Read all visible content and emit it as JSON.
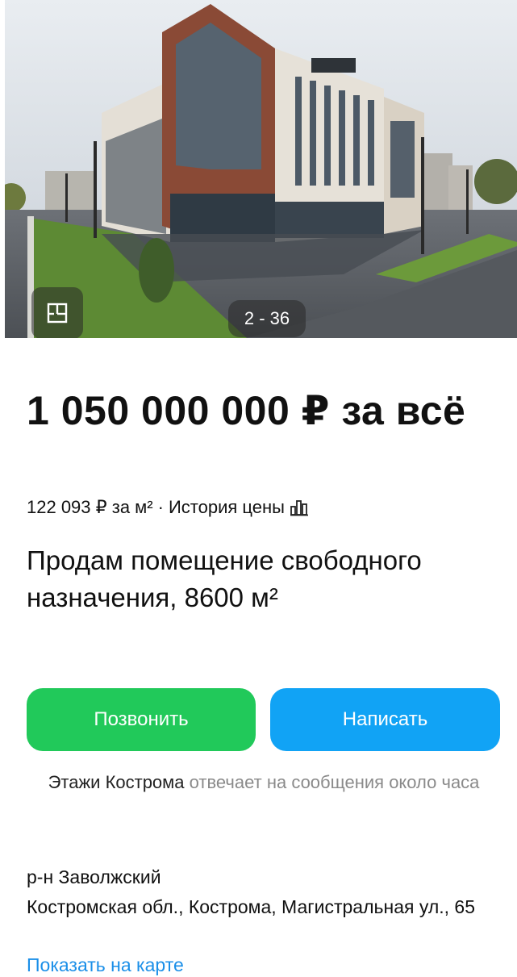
{
  "gallery": {
    "counter": "2 - 36",
    "icons": {
      "plan": "floor-plan-icon"
    }
  },
  "listing": {
    "price": "1 050 000 000 ₽ за всё",
    "price_per_m2": "122 093 ₽ за м²",
    "separator": "·",
    "price_history": "История цены",
    "title": "Продам помещение свободного назначения, 8600 м²"
  },
  "actions": {
    "call": "Позвонить",
    "write": "Написать"
  },
  "seller": {
    "name": "Этажи Кострома",
    "response_text": "отвечает на сообщения около часа"
  },
  "location": {
    "district": "р-н Заволжский",
    "address": "Костромская обл., Кострома, Магистральная ул., 65",
    "map_link": "Показать на карте"
  },
  "colors": {
    "call_button": "#21c95a",
    "write_button": "#11a3f5",
    "link": "#1b8fe8"
  }
}
